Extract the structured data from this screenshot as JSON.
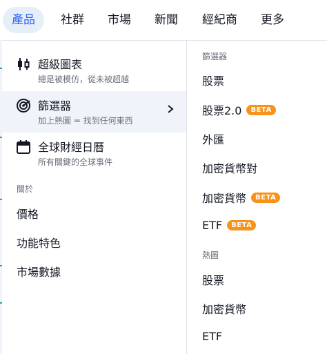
{
  "nav": {
    "items": [
      {
        "label": "產品",
        "active": true
      },
      {
        "label": "社群"
      },
      {
        "label": "市場"
      },
      {
        "label": "新聞"
      },
      {
        "label": "經紀商"
      },
      {
        "label": "更多"
      }
    ]
  },
  "tools": [
    {
      "title": "超級圖表",
      "subtitle": "總是被模仿，從未被超越",
      "icon": "candlestick-icon"
    },
    {
      "title": "篩選器",
      "subtitle": "加上熱圖 = 找到任何東西",
      "icon": "target-icon",
      "has_submenu": true
    },
    {
      "title": "全球財經日曆",
      "subtitle": "所有關鍵的全球事件",
      "icon": "calendar-icon"
    }
  ],
  "about": {
    "heading": "關於",
    "items": [
      "價格",
      "功能特色",
      "市場數據"
    ]
  },
  "screeners": {
    "heading": "篩選器",
    "items": [
      {
        "label": "股票"
      },
      {
        "label": "股票2.0",
        "badge": "BETA"
      },
      {
        "label": "外匯"
      },
      {
        "label": "加密貨幣對"
      },
      {
        "label": "加密貨幣",
        "badge": "BETA"
      },
      {
        "label": "ETF",
        "badge": "BETA"
      }
    ]
  },
  "heatmaps": {
    "heading": "熱圖",
    "items": [
      {
        "label": "股票"
      },
      {
        "label": "加密貨幣"
      },
      {
        "label": "ETF"
      }
    ]
  },
  "colors": {
    "accent": "#2962ff",
    "badge": "#f7931a",
    "hover": "#f0f3fa"
  }
}
